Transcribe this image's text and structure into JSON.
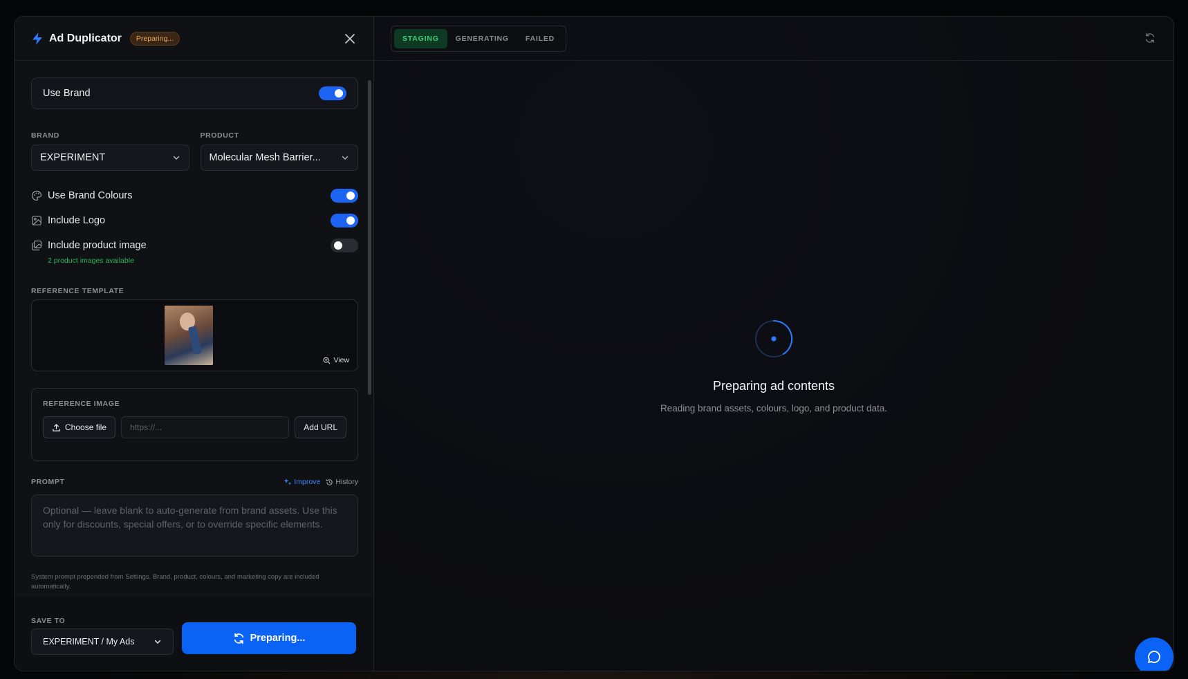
{
  "header": {
    "title": "Ad Duplicator",
    "status_badge": "Preparing..."
  },
  "use_brand": {
    "label": "Use Brand",
    "on": true
  },
  "brand": {
    "label": "BRAND",
    "value": "EXPERIMENT"
  },
  "product": {
    "label": "PRODUCT",
    "value": "Molecular Mesh Barrier..."
  },
  "options": {
    "brand_colours": {
      "label": "Use Brand Colours",
      "on": true
    },
    "logo": {
      "label": "Include Logo",
      "on": true
    },
    "product_image": {
      "label": "Include product image",
      "on": false,
      "note": "2 product images available"
    }
  },
  "reference_template": {
    "label": "REFERENCE TEMPLATE",
    "view_label": "View"
  },
  "reference_image": {
    "label": "REFERENCE IMAGE",
    "choose_file": "Choose file",
    "url_placeholder": "https://...",
    "add_url": "Add URL"
  },
  "prompt": {
    "label": "PROMPT",
    "improve": "Improve",
    "history": "History",
    "placeholder": "Optional — leave blank to auto-generate from brand assets. Use this only for discounts, special offers, or to override specific elements.",
    "note": "System prompt prepended from Settings. Brand, product, colours, and marketing copy are included automatically."
  },
  "footer": {
    "save_label": "SAVE TO",
    "save_value": "EXPERIMENT / My Ads",
    "primary": "Preparing..."
  },
  "right": {
    "tabs": [
      "STAGING",
      "GENERATING",
      "FAILED"
    ],
    "active_tab": "STAGING",
    "status_title": "Preparing ad contents",
    "status_sub": "Reading brand assets, colours, logo, and product data."
  },
  "colors": {
    "accent": "#0b63f6",
    "success": "#3ccf7a",
    "warning": "#e8a35a"
  }
}
